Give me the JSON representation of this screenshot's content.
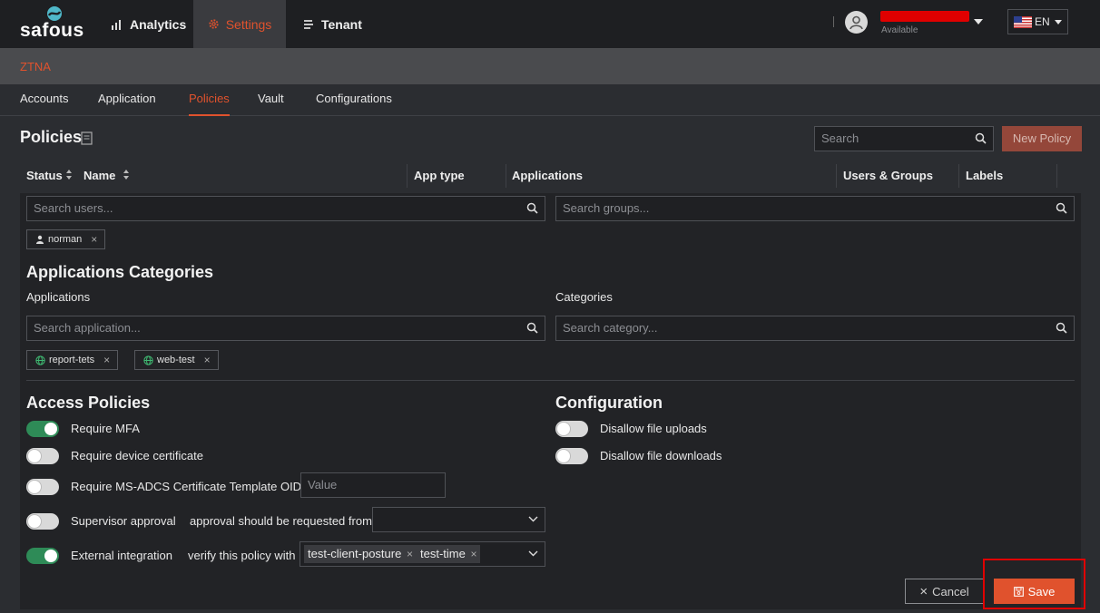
{
  "topbar": {
    "logo": "safous",
    "tabs": [
      {
        "label": "Analytics",
        "icon": "bar-chart-icon"
      },
      {
        "label": "Settings",
        "icon": "gear-icon"
      },
      {
        "label": "Tenant",
        "icon": "tenant-icon"
      }
    ],
    "user_status": "Available",
    "language": "EN"
  },
  "section": "ZTNA",
  "subnav": [
    "Accounts",
    "Application",
    "Policies",
    "Vault",
    "Configurations"
  ],
  "page": {
    "title": "Policies",
    "search_placeholder": "Search",
    "new_policy": "New Policy"
  },
  "table_headers": {
    "status": "Status",
    "name": "Name",
    "app_type": "App type",
    "applications": "Applications",
    "users_groups": "Users & Groups",
    "labels": "Labels"
  },
  "editor": {
    "search_users": "Search users...",
    "search_groups": "Search groups...",
    "user_chips": [
      "norman"
    ],
    "app_categories_title": "Applications Categories",
    "applications_label": "Applications",
    "categories_label": "Categories",
    "search_application": "Search application...",
    "search_category": "Search category...",
    "app_chips": [
      "report-tets",
      "web-test"
    ],
    "access_title": "Access Policies",
    "config_title": "Configuration",
    "access": [
      {
        "label": "Require MFA",
        "on": true
      },
      {
        "label": "Require device certificate",
        "on": false
      },
      {
        "label": "Require MS-ADCS Certificate Template OID",
        "on": false
      },
      {
        "label": "Supervisor approval",
        "on": false
      },
      {
        "label": "External integration",
        "on": true
      }
    ],
    "oid_placeholder": "Value",
    "approval_text": "approval should be requested from",
    "verify_text": "verify this policy with",
    "verify_chips": [
      "test-client-posture",
      "test-time"
    ],
    "config": [
      {
        "label": "Disallow file uploads",
        "on": false
      },
      {
        "label": "Disallow file downloads",
        "on": false
      }
    ],
    "cancel": "Cancel",
    "save": "Save"
  },
  "colors": {
    "accent": "#e0522d",
    "toggle_on": "#2e8b57",
    "highlight": "#e00000"
  }
}
